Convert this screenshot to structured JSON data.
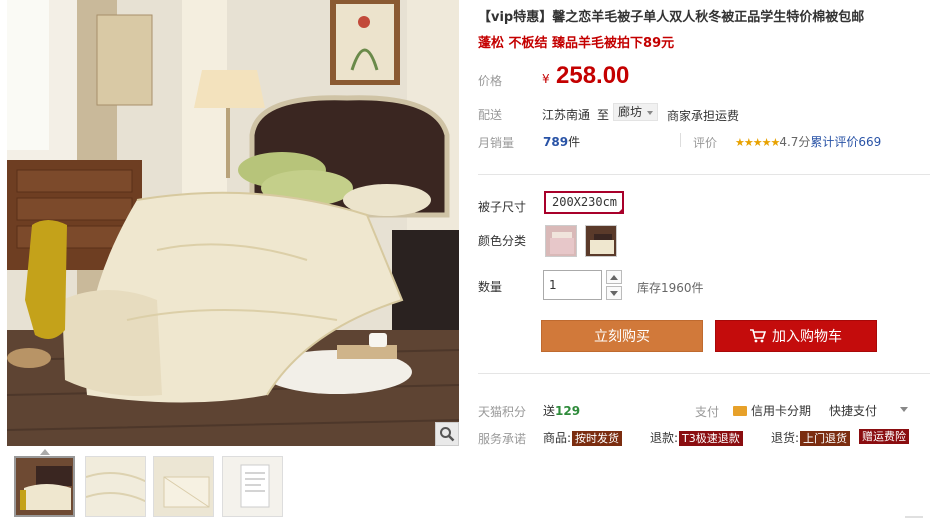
{
  "product": {
    "title_tag": "【vip特惠】",
    "title_text": "馨之恋羊毛被子单人双人秋冬被正品学生特价棉被包邮",
    "subtitle": "蓬松 不板结 臻品羊毛被拍下89元"
  },
  "price": {
    "label": "价格",
    "currency": "¥",
    "value": "258.00"
  },
  "shipping": {
    "label": "配送",
    "from": "江苏南通",
    "to_word": "至",
    "dest": "廊坊",
    "fee_text": "商家承担运费"
  },
  "sales": {
    "label": "月销量",
    "count": "789",
    "unit": "件",
    "review_label": "评价",
    "stars": "★★★★★",
    "score_text": "4.7分",
    "review_text": "累计评价669"
  },
  "options": {
    "size_label": "被子尺寸",
    "size_value": "200X230cm",
    "color_label": "颜色分类",
    "qty_label": "数量",
    "qty_value": "1",
    "stock_text": "库存1960件"
  },
  "actions": {
    "buy_label": "立刻购买",
    "cart_label": "加入购物车"
  },
  "extra": {
    "points_label": "天猫积分",
    "points_prefix": "送",
    "points_value": "129",
    "pay_label": "支付",
    "credit_label": "信用卡分期",
    "quick_pay": "快捷支付",
    "service_label": "服务承诺",
    "goods_label": "商品:",
    "goods_tag": "按时发货",
    "refund_label": "退款:",
    "refund_tag": "T3极速退款",
    "return_label": "退货:",
    "return_tag": "上门退货",
    "insurance_tag": "赠运费险"
  },
  "colors": {
    "accent_red": "#c40000",
    "buy_orange": "#d1793a",
    "cart_red": "#c40c0c",
    "link_blue": "#2953a6"
  },
  "icons": {
    "zoom": "magnifier-icon",
    "cart": "shopping-cart-icon",
    "credit": "credit-card-icon",
    "caret": "chevron-down-icon"
  }
}
